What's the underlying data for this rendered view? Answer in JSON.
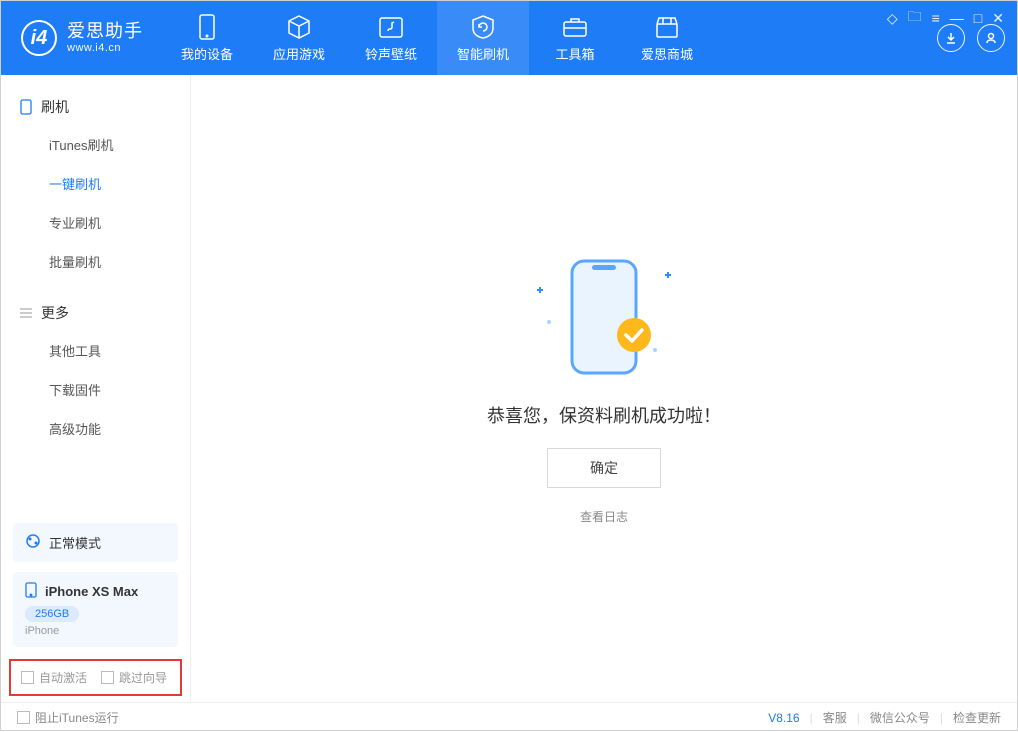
{
  "app": {
    "title": "爱思助手",
    "subtitle": "www.i4.cn"
  },
  "nav": {
    "tabs": [
      {
        "label": "我的设备",
        "icon": "device"
      },
      {
        "label": "应用游戏",
        "icon": "cube"
      },
      {
        "label": "铃声壁纸",
        "icon": "music"
      },
      {
        "label": "智能刷机",
        "icon": "refresh",
        "active": true
      },
      {
        "label": "工具箱",
        "icon": "toolbox"
      },
      {
        "label": "爱思商城",
        "icon": "store"
      }
    ]
  },
  "sidebar": {
    "section1": {
      "title": "刷机",
      "items": [
        {
          "label": "iTunes刷机"
        },
        {
          "label": "一键刷机",
          "active": true
        },
        {
          "label": "专业刷机"
        },
        {
          "label": "批量刷机"
        }
      ]
    },
    "section2": {
      "title": "更多",
      "items": [
        {
          "label": "其他工具"
        },
        {
          "label": "下载固件"
        },
        {
          "label": "高级功能"
        }
      ]
    },
    "mode_card": {
      "label": "正常模式"
    },
    "device_card": {
      "name": "iPhone XS Max",
      "capacity": "256GB",
      "type": "iPhone"
    },
    "options": {
      "auto_activate": "自动激活",
      "skip_guide": "跳过向导"
    }
  },
  "main": {
    "success_message": "恭喜您，保资料刷机成功啦！",
    "ok_button": "确定",
    "view_log": "查看日志"
  },
  "footer": {
    "block_itunes": "阻止iTunes运行",
    "version": "V8.16",
    "links": {
      "support": "客服",
      "wechat": "微信公众号",
      "update": "检查更新"
    }
  }
}
